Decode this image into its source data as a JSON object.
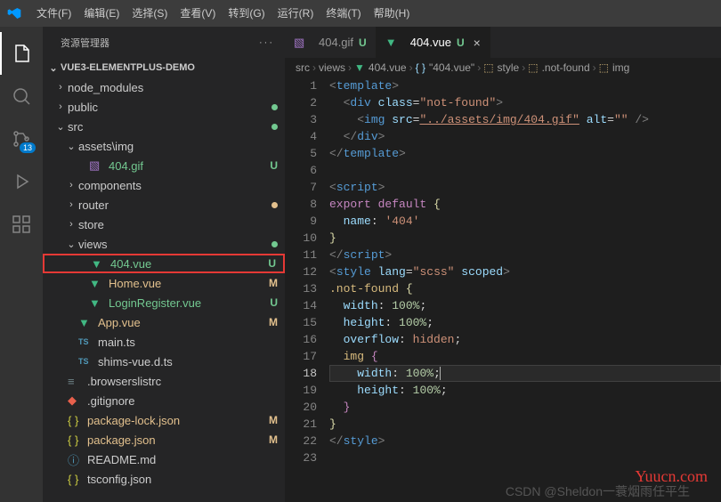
{
  "menu": [
    "文件(F)",
    "编辑(E)",
    "选择(S)",
    "查看(V)",
    "转到(G)",
    "运行(R)",
    "终端(T)",
    "帮助(H)"
  ],
  "sidebar": {
    "title": "资源管理器",
    "project": "VUE3-ELEMENTPLUS-DEMO"
  },
  "scm_badge": "13",
  "tree": [
    {
      "name": "node_modules",
      "icon": "folder",
      "indent": 1,
      "chev": ">"
    },
    {
      "name": "public",
      "icon": "folder",
      "indent": 1,
      "chev": ">",
      "dot": "untracked"
    },
    {
      "name": "src",
      "icon": "folder",
      "indent": 1,
      "chev": "v",
      "dot": "untracked"
    },
    {
      "name": "assets\\img",
      "icon": "folder",
      "indent": 2,
      "chev": "v"
    },
    {
      "name": "404.gif",
      "icon": "img",
      "indent": 3,
      "status": "U"
    },
    {
      "name": "components",
      "icon": "folder",
      "indent": 2,
      "chev": ">"
    },
    {
      "name": "router",
      "icon": "folder",
      "indent": 2,
      "chev": ">",
      "dot": "modified"
    },
    {
      "name": "store",
      "icon": "folder",
      "indent": 2,
      "chev": ">"
    },
    {
      "name": "views",
      "icon": "folder",
      "indent": 2,
      "chev": "v",
      "dot": "untracked"
    },
    {
      "name": "404.vue",
      "icon": "vue",
      "indent": 3,
      "status": "U",
      "highlight": true
    },
    {
      "name": "Home.vue",
      "icon": "vue",
      "indent": 3,
      "status": "M"
    },
    {
      "name": "LoginRegister.vue",
      "icon": "vue",
      "indent": 3,
      "status": "U"
    },
    {
      "name": "App.vue",
      "icon": "vue",
      "indent": 2,
      "status": "M"
    },
    {
      "name": "main.ts",
      "icon": "ts",
      "indent": 2
    },
    {
      "name": "shims-vue.d.ts",
      "icon": "ts",
      "indent": 2
    },
    {
      "name": ".browserslistrc",
      "icon": "bl",
      "indent": 1
    },
    {
      "name": ".gitignore",
      "icon": "git",
      "indent": 1
    },
    {
      "name": "package-lock.json",
      "icon": "json",
      "indent": 1,
      "status": "M"
    },
    {
      "name": "package.json",
      "icon": "json",
      "indent": 1,
      "status": "M"
    },
    {
      "name": "README.md",
      "icon": "md",
      "indent": 1
    },
    {
      "name": "tsconfig.json",
      "icon": "json",
      "indent": 1
    }
  ],
  "tabs": [
    {
      "label": "404.gif",
      "icon": "img",
      "status": "U"
    },
    {
      "label": "404.vue",
      "icon": "vue",
      "status": "U",
      "active": true
    }
  ],
  "breadcrumbs": [
    "src",
    "views",
    "404.vue",
    "\"404.vue\"",
    "style",
    ".not-found",
    "img"
  ],
  "bc_icons": [
    "",
    "",
    "vue",
    "brace",
    "css",
    "css",
    "css"
  ],
  "code": {
    "lines": [
      {
        "n": 1,
        "html": "<span class='t-bracket'>&lt;</span><span class='t-tag'>template</span><span class='t-bracket'>&gt;</span>"
      },
      {
        "n": 2,
        "html": "  <span class='t-bracket'>&lt;</span><span class='t-tag'>div</span> <span class='t-attr'>class</span>=<span class='t-str'>\"not-found\"</span><span class='t-bracket'>&gt;</span>"
      },
      {
        "n": 3,
        "html": "    <span class='t-bracket'>&lt;</span><span class='t-tag'>img</span> <span class='t-attr'>src</span>=<span class='t-str t-under'>\"../assets/img/404.gif\"</span> <span class='t-attr'>alt</span>=<span class='t-str'>\"\"</span> <span class='t-bracket'>/&gt;</span>"
      },
      {
        "n": 4,
        "html": "  <span class='t-bracket'>&lt;/</span><span class='t-tag'>div</span><span class='t-bracket'>&gt;</span>"
      },
      {
        "n": 5,
        "html": "<span class='t-bracket'>&lt;/</span><span class='t-tag'>template</span><span class='t-bracket'>&gt;</span>"
      },
      {
        "n": 6,
        "html": ""
      },
      {
        "n": 7,
        "html": "<span class='t-bracket'>&lt;</span><span class='t-tag'>script</span><span class='t-bracket'>&gt;</span>"
      },
      {
        "n": 8,
        "html": "<span class='t-kw'>export</span> <span class='t-kw'>default</span> <span class='t-yellow'>{</span>"
      },
      {
        "n": 9,
        "html": "  <span class='t-prop'>name</span>: <span class='t-str'>'404'</span>"
      },
      {
        "n": 10,
        "html": "<span class='t-yellow'>}</span>"
      },
      {
        "n": 11,
        "html": "<span class='t-bracket'>&lt;/</span><span class='t-tag'>script</span><span class='t-bracket'>&gt;</span>"
      },
      {
        "n": 12,
        "html": "<span class='t-bracket'>&lt;</span><span class='t-tag'>style</span> <span class='t-attr'>lang</span>=<span class='t-str'>\"scss\"</span> <span class='t-attr'>scoped</span><span class='t-bracket'>&gt;</span>"
      },
      {
        "n": 13,
        "html": "<span class='t-sel'>.not-found</span> <span class='t-yellow'>{</span>"
      },
      {
        "n": 14,
        "html": "  <span class='t-prop'>width</span>: <span class='t-num'>100%</span>;"
      },
      {
        "n": 15,
        "html": "  <span class='t-prop'>height</span>: <span class='t-num'>100%</span>;"
      },
      {
        "n": 16,
        "html": "  <span class='t-prop'>overflow</span>: <span class='t-str'>hidden</span>;"
      },
      {
        "n": 17,
        "html": "  <span class='t-sel'>img</span> <span class='t-kw'>{</span>"
      },
      {
        "n": 18,
        "html": "    <span class='t-prop'>width</span>: <span class='t-num'>100%</span>;<span class='t-cursor'></span>",
        "current": true
      },
      {
        "n": 19,
        "html": "    <span class='t-prop'>height</span>: <span class='t-num'>100%</span>;"
      },
      {
        "n": 20,
        "html": "  <span class='t-kw'>}</span>"
      },
      {
        "n": 21,
        "html": "<span class='t-yellow'>}</span>"
      },
      {
        "n": 22,
        "html": "<span class='t-bracket'>&lt;/</span><span class='t-tag'>style</span><span class='t-bracket'>&gt;</span>"
      },
      {
        "n": 23,
        "html": ""
      }
    ]
  },
  "watermark": "Yuucn.com",
  "watermark2": "CSDN @Sheldon一蓑烟雨任平生"
}
